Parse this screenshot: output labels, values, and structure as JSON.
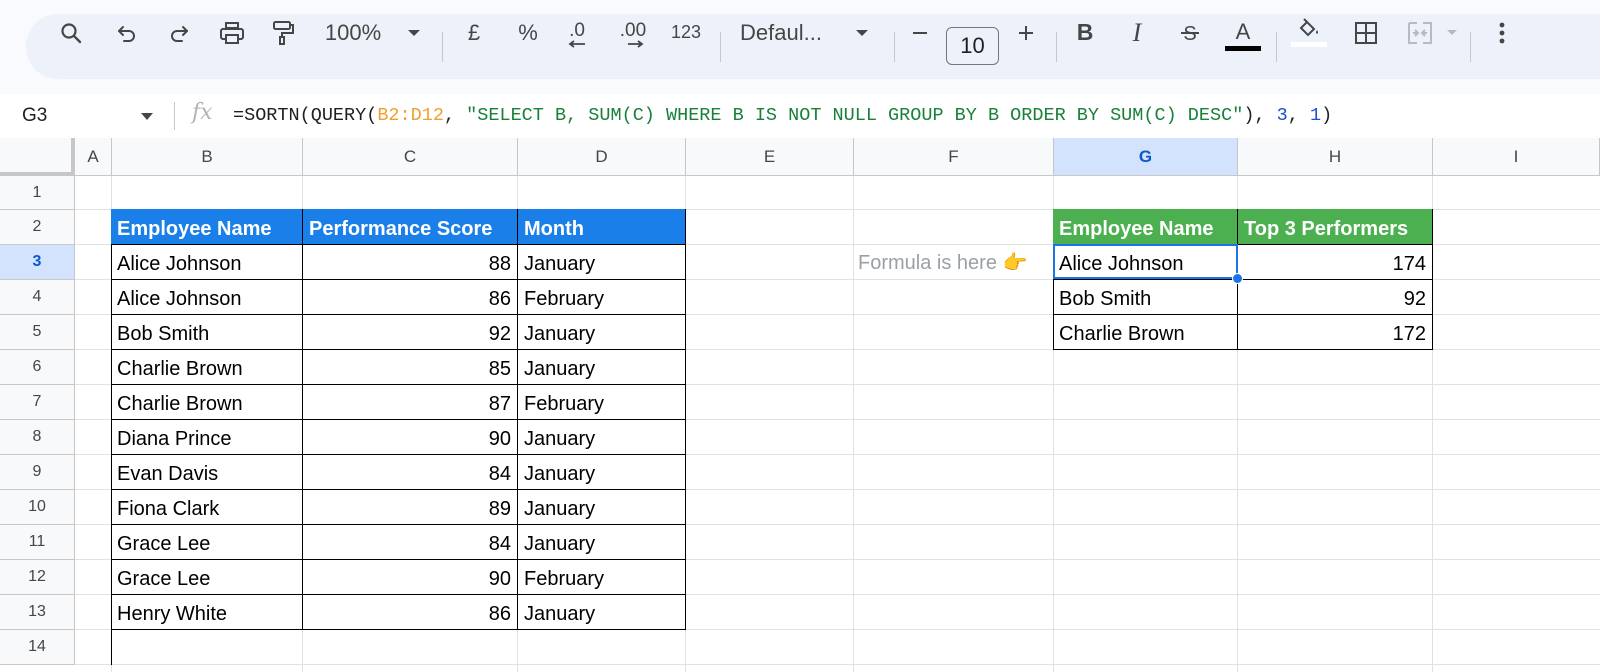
{
  "toolbar": {
    "zoom": "100%",
    "currency": "£",
    "percent": "%",
    "decrease_decimal": ".0",
    "increase_decimal": ".00",
    "more_formats": "123",
    "font": "Defaul...",
    "font_size": "10",
    "icons": [
      "search-icon",
      "undo-icon",
      "redo-icon",
      "print-icon",
      "paint-format-icon",
      "bold-icon",
      "italic-icon",
      "strikethrough-icon",
      "text-color-icon",
      "fill-color-icon",
      "borders-icon",
      "merge-cells-icon",
      "more-icon"
    ],
    "text_color": "#000000"
  },
  "formula_bar": {
    "cell_ref": "G3",
    "fn_open": "=SORTN(QUERY(",
    "range": "B2:D12",
    "comma1": ", ",
    "query_string": "\"SELECT B, SUM(C) WHERE B IS NOT NULL GROUP BY B ORDER BY SUM(C) DESC\"",
    "close1": "), ",
    "arg_n": "3",
    "comma2": ", ",
    "arg_mode": "1",
    "close2": ")"
  },
  "columns": [
    "A",
    "B",
    "C",
    "D",
    "E",
    "F",
    "G",
    "H",
    "I"
  ],
  "selected_column": "G",
  "rows": [
    "1",
    "2",
    "3",
    "4",
    "5",
    "6",
    "7",
    "8",
    "9",
    "10",
    "11",
    "12",
    "13",
    "14"
  ],
  "selected_row": "3",
  "source_table": {
    "headers": [
      "Employee  Name",
      "Performance Score",
      "Month"
    ],
    "rows": [
      [
        "Alice Johnson",
        "88",
        "January"
      ],
      [
        "Alice Johnson",
        "86",
        "February"
      ],
      [
        "Bob Smith",
        "92",
        "January"
      ],
      [
        "Charlie Brown",
        "85",
        "January"
      ],
      [
        "Charlie Brown",
        "87",
        "February"
      ],
      [
        "Diana Prince",
        "90",
        "January"
      ],
      [
        "Evan Davis",
        "84",
        "January"
      ],
      [
        "Fiona Clark",
        "89",
        "January"
      ],
      [
        "Grace Lee",
        "84",
        "January"
      ],
      [
        "Grace Lee",
        "90",
        "February"
      ],
      [
        "Henry White",
        "86",
        "January"
      ]
    ],
    "header_color": "#1a7fe8"
  },
  "note": "Formula is here 👉",
  "result_table": {
    "headers": [
      "Employee Name",
      "Top 3 Performers"
    ],
    "rows": [
      [
        "Alice Johnson",
        "174"
      ],
      [
        "Bob Smith",
        "92"
      ],
      [
        "Charlie Brown",
        "172"
      ]
    ],
    "header_color": "#4caf50"
  },
  "selection_color": "#1a73e8"
}
